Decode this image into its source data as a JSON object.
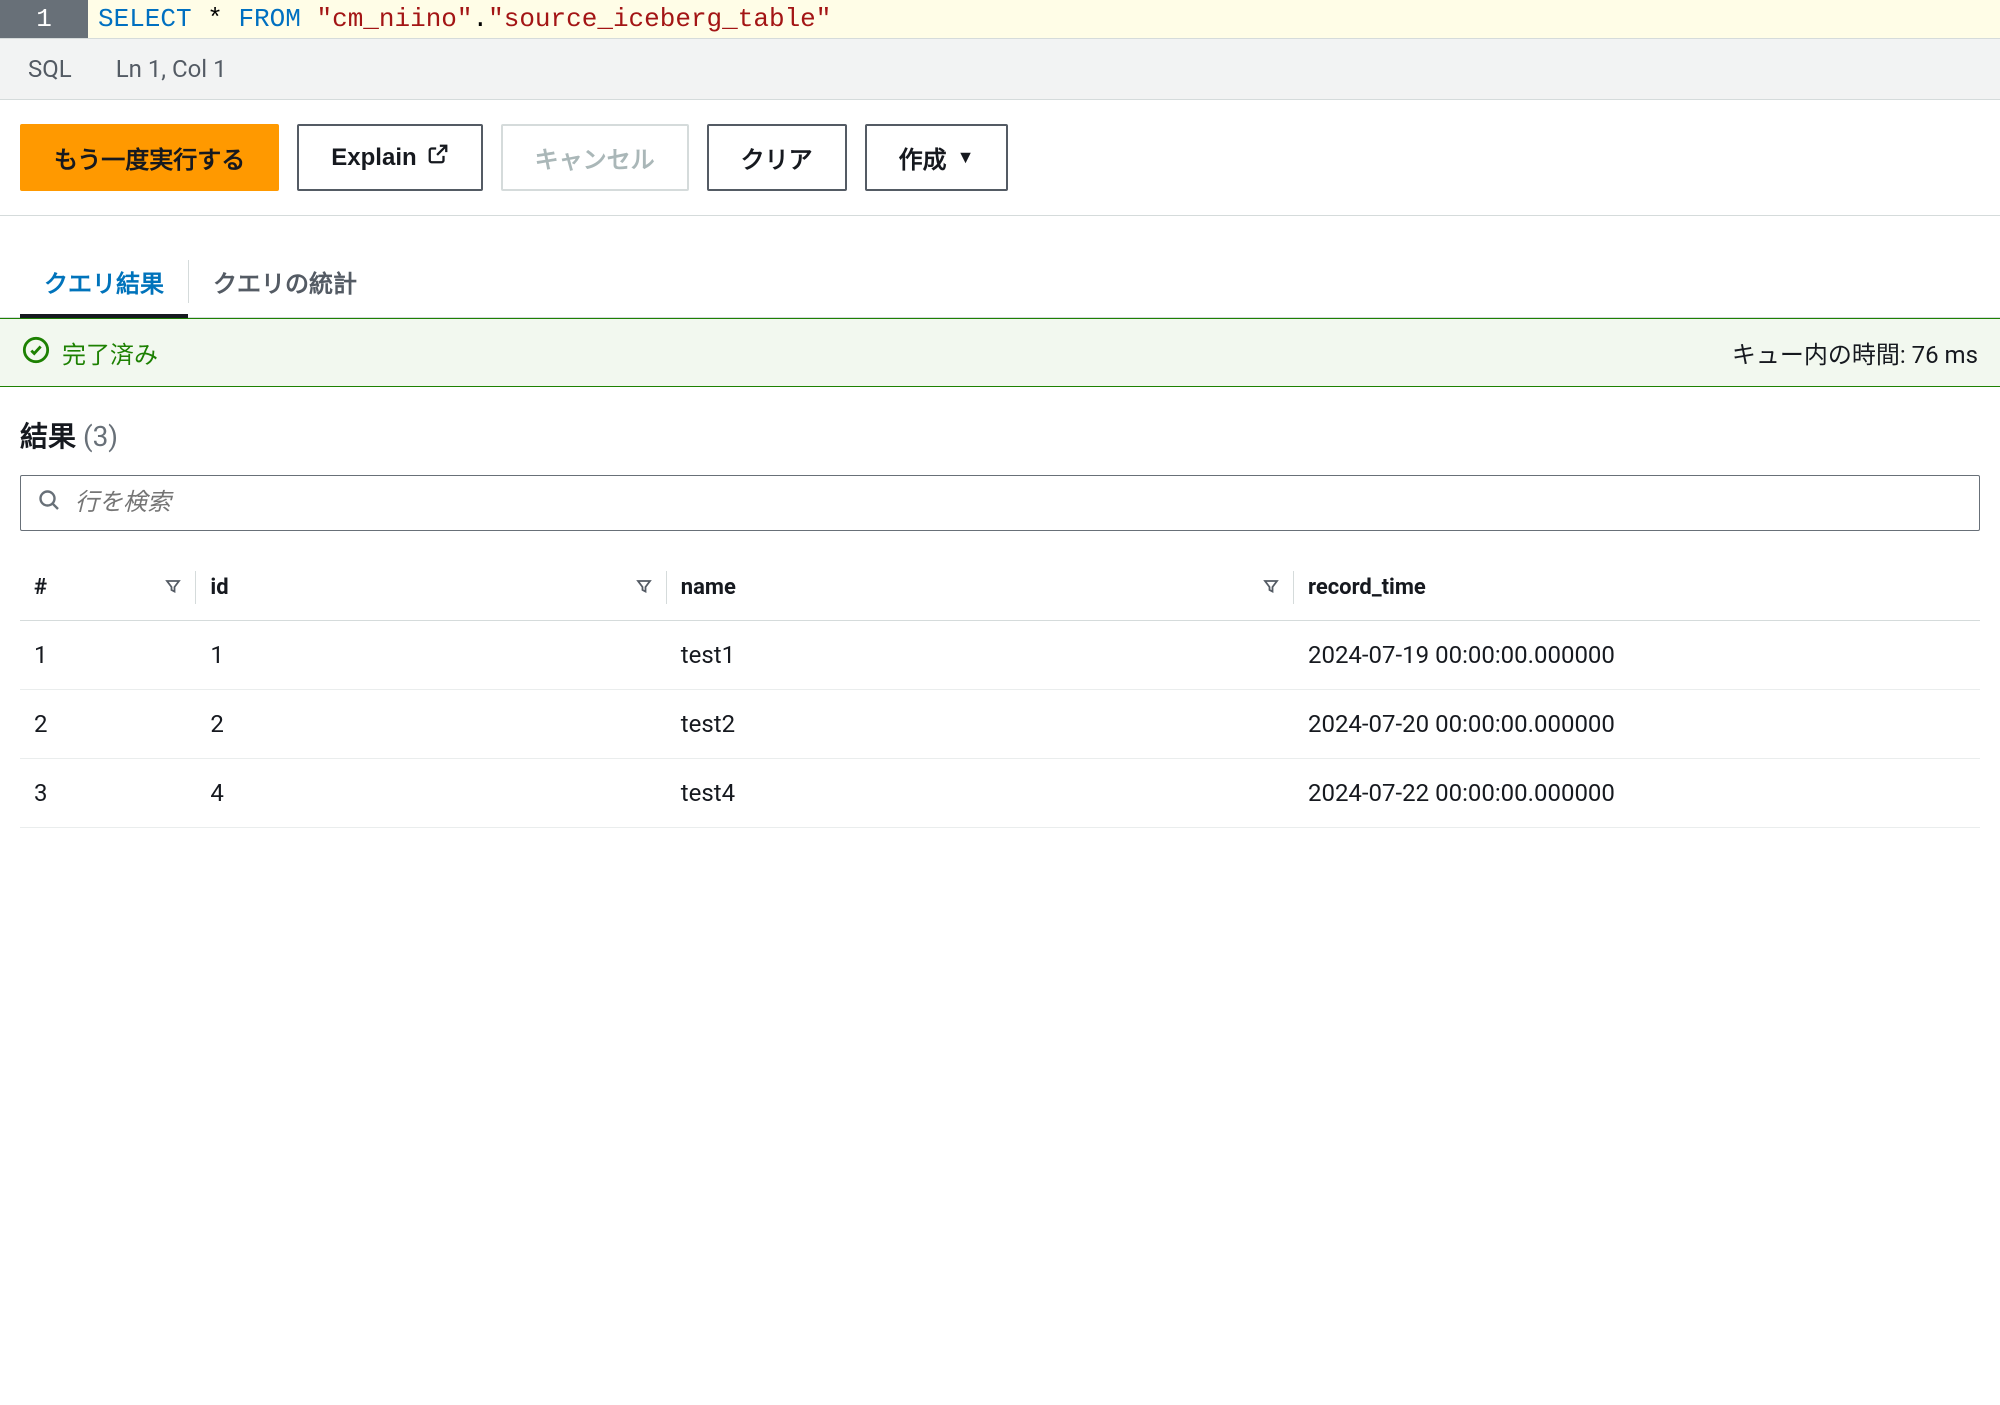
{
  "editor": {
    "line_number": "1",
    "sql_tokens": {
      "select": "SELECT",
      "star": "*",
      "from": "FROM",
      "schema": "\"cm_niino\"",
      "dot": ".",
      "table": "\"source_iceberg_table\""
    }
  },
  "statusbar": {
    "lang": "SQL",
    "position": "Ln 1, Col 1"
  },
  "buttons": {
    "run": "もう一度実行する",
    "explain": "Explain",
    "cancel": "キャンセル",
    "clear": "クリア",
    "create": "作成"
  },
  "tabs": {
    "results": "クエリ結果",
    "stats": "クエリの統計"
  },
  "banner": {
    "status": "完了済み",
    "queue_label": "キュー内の時間:",
    "queue_value": "76 ms"
  },
  "results": {
    "title": "結果",
    "count": "(3)",
    "search_placeholder": "行を検索",
    "columns": {
      "rownum": "#",
      "id": "id",
      "name": "name",
      "record_time": "record_time"
    },
    "rows": [
      {
        "rownum": "1",
        "id": "1",
        "name": "test1",
        "record_time": "2024-07-19 00:00:00.000000"
      },
      {
        "rownum": "2",
        "id": "2",
        "name": "test2",
        "record_time": "2024-07-20 00:00:00.000000"
      },
      {
        "rownum": "3",
        "id": "4",
        "name": "test4",
        "record_time": "2024-07-22 00:00:00.000000"
      }
    ]
  }
}
